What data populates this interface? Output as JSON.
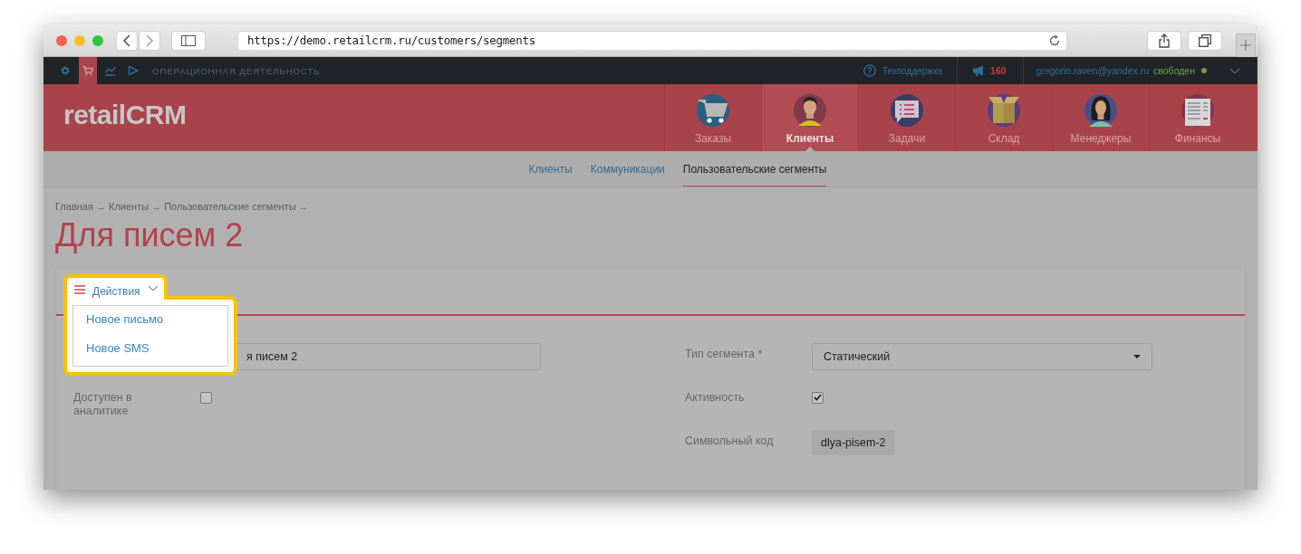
{
  "browser": {
    "url": "https://demo.retailcrm.ru/customers/segments"
  },
  "topbar": {
    "icons": [
      {
        "kind": "gear",
        "selected": false
      },
      {
        "kind": "cart",
        "selected": true
      },
      {
        "kind": "chart",
        "selected": false
      },
      {
        "kind": "play",
        "selected": false
      }
    ],
    "section": "ОПЕРАЦИОННАЯ ДЕЯТЕЛЬНОСТЬ",
    "support": "Техподдержка",
    "notifications": "160",
    "user": "gregorio.raven@yandex.ru",
    "status": "свободен"
  },
  "logo": "retailCRM",
  "nav": [
    {
      "label": "Заказы",
      "kind": "cart",
      "selected": false
    },
    {
      "label": "Клиенты",
      "kind": "man",
      "selected": true
    },
    {
      "label": "Задачи",
      "kind": "chat",
      "selected": false
    },
    {
      "label": "Склад",
      "kind": "box",
      "selected": false
    },
    {
      "label": "Менеджеры",
      "kind": "woman",
      "selected": false
    },
    {
      "label": "Финансы",
      "kind": "document",
      "selected": false
    }
  ],
  "subnav": [
    {
      "label": "Клиенты",
      "selected": false
    },
    {
      "label": "Коммуникации",
      "selected": false
    },
    {
      "label": "Пользовательские сегменты",
      "selected": true
    }
  ],
  "breadcrumbs": "Главная → Клиенты → Пользовательские сегменты →",
  "title": "Для писем 2",
  "actions": {
    "label": "Действия",
    "expanded": true,
    "items": [
      "Новое письмо",
      "Новое SMS"
    ]
  },
  "form": {
    "left": [
      {
        "kind": "text",
        "value": "я писем 2"
      },
      {
        "kind": "checkbox",
        "label": "Доступен в аналитике",
        "checked": false
      }
    ],
    "right": [
      {
        "kind": "select",
        "label": "Тип сегмента",
        "required_mark": "*",
        "value": "Статический"
      },
      {
        "kind": "checkbox",
        "label": "Активность",
        "checked": true
      },
      {
        "kind": "code",
        "label": "Символьный код",
        "value": "dlya-pisem-2"
      }
    ]
  }
}
